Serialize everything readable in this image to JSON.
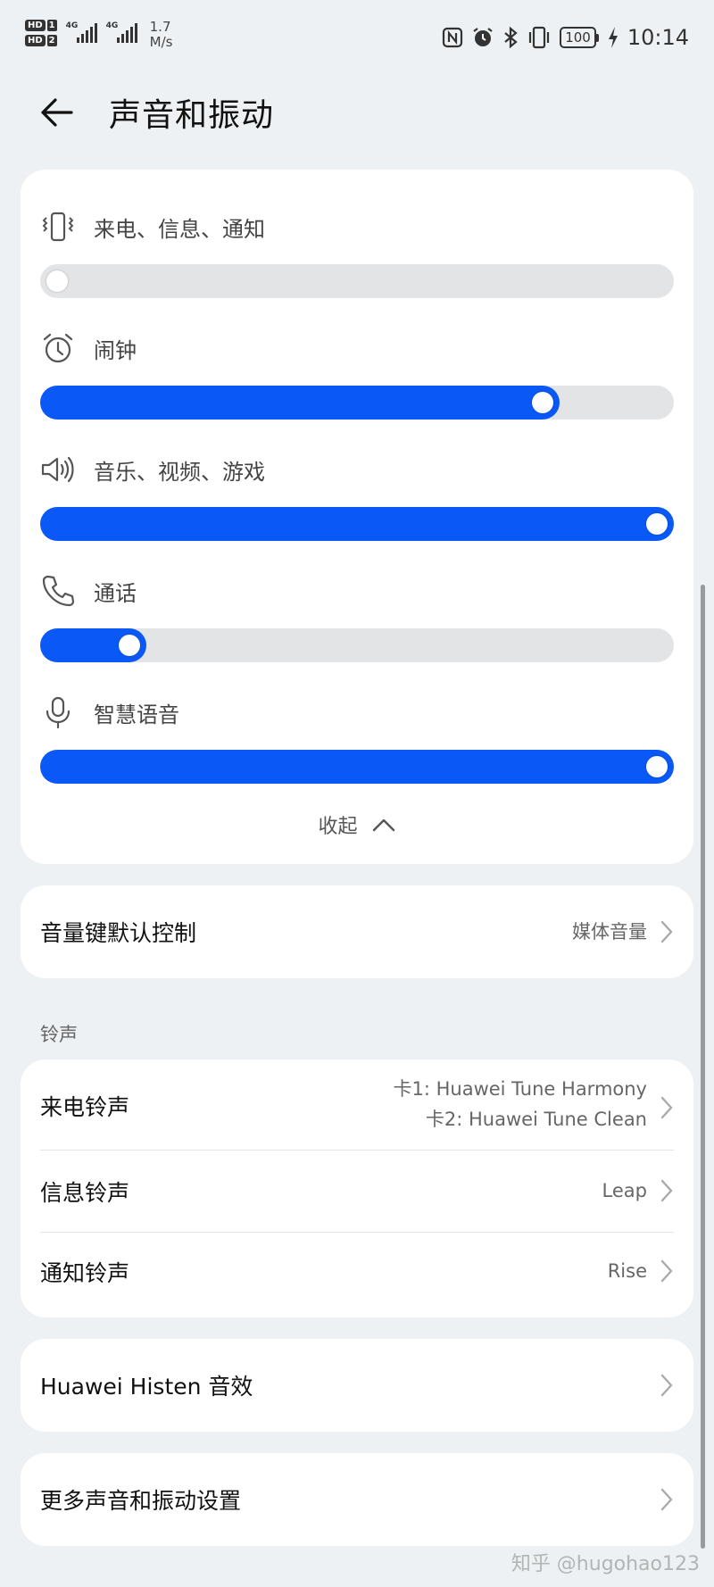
{
  "status_bar": {
    "sim1": {
      "hd": "HD",
      "num": "1",
      "network": "4G"
    },
    "sim2": {
      "hd": "HD",
      "num": "2",
      "network": "4G"
    },
    "speed_value": "1.7",
    "speed_unit": "M/s",
    "battery": "100",
    "time": "10:14",
    "icons": [
      "nfc-icon",
      "alarm-icon",
      "bluetooth-icon",
      "vibrate-icon",
      "battery-icon",
      "charging-icon"
    ]
  },
  "header": {
    "title": "声音和振动"
  },
  "volumes": [
    {
      "id": "ring",
      "label": "来电、信息、通知",
      "icon": "vibrate-icon",
      "level": 0.0
    },
    {
      "id": "alarm",
      "label": "闹钟",
      "icon": "alarm-clock-icon",
      "level": 0.81
    },
    {
      "id": "media",
      "label": "音乐、视频、游戏",
      "icon": "speaker-icon",
      "level": 1.0
    },
    {
      "id": "call",
      "label": "通话",
      "icon": "phone-icon",
      "level": 0.12
    },
    {
      "id": "voice",
      "label": "智慧语音",
      "icon": "microphone-icon",
      "level": 1.0
    }
  ],
  "collapse_label": "收起",
  "volume_key": {
    "title": "音量键默认控制",
    "value": "媒体音量"
  },
  "ringtone_section": {
    "label": "铃声",
    "incoming": {
      "title": "来电铃声",
      "value_line1": "卡1: Huawei Tune Harmony",
      "value_line2": "卡2: Huawei Tune Clean"
    },
    "message": {
      "title": "信息铃声",
      "value": "Leap"
    },
    "notification": {
      "title": "通知铃声",
      "value": "Rise"
    }
  },
  "histen": {
    "title": "Huawei Histen 音效"
  },
  "more_settings": {
    "title": "更多声音和振动设置"
  },
  "watermark": "知乎 @hugohao123",
  "colors": {
    "accent": "#0a59f7",
    "track": "#e3e4e6",
    "background": "#eef1f3",
    "card": "#ffffff"
  }
}
